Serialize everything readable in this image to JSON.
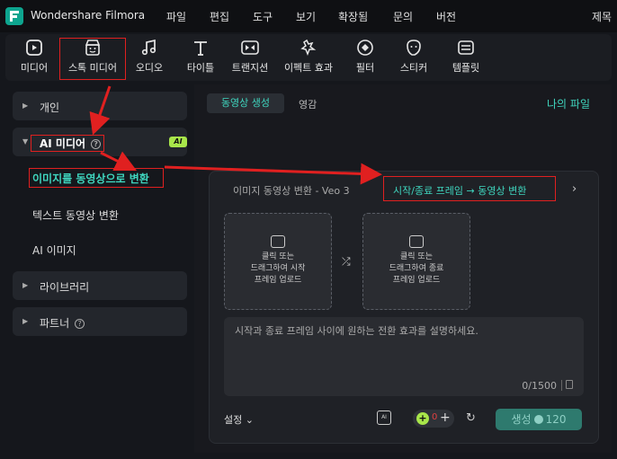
{
  "app": {
    "title": "Wondershare Filmora",
    "logo": "filmora-logo-icon"
  },
  "menu": [
    "파일",
    "편집",
    "도구",
    "보기",
    "확장됨",
    "문의",
    "버전",
    "제목"
  ],
  "toolbar": {
    "items": [
      {
        "label": "미디어",
        "icon": "media-icon"
      },
      {
        "label": "스톡 미디어",
        "icon": "stock-media-icon"
      },
      {
        "label": "오디오",
        "icon": "music-note-icon"
      },
      {
        "label": "타이틀",
        "icon": "text-t-icon"
      },
      {
        "label": "트랜지션",
        "icon": "transition-icon"
      },
      {
        "label": "이펙트 효과",
        "icon": "effects-icon"
      },
      {
        "label": "필터",
        "icon": "filter-icon"
      },
      {
        "label": "스티커",
        "icon": "sticker-icon"
      },
      {
        "label": "템플릿",
        "icon": "template-icon"
      }
    ]
  },
  "sidebar": {
    "personal": "개인",
    "ai_media": "AI 미디어",
    "ai_badge": "AI",
    "items": [
      "이미지를 동영상으로 변환",
      "텍스트 동영상 변환",
      "AI 이미지"
    ],
    "library": "라이브러리",
    "partner": "파트너"
  },
  "main": {
    "tab_active": "동영상 생성",
    "tab_other": "영감",
    "my_files": "나의 파일"
  },
  "panel": {
    "tab1": "이미지 동영상 변환 - Veo 3",
    "tab2": "시작/종료 프레임 → 동영상 변환",
    "chevron": "›",
    "upload_start": "클릭 또는\n드래그하여 시작\n프레임 업로드",
    "upload_end": "클릭 또는\n드래그하여 종료\n프레임 업로드",
    "prompt_placeholder": "시작과 종료 프레임 사이에 원하는 전환 효과를 설명하세요.",
    "char_count": "0/1500",
    "settings_label": "설정",
    "credit_value": "0",
    "generate_label": "생성",
    "generate_cost": "120"
  },
  "colors": {
    "accent": "#3fd6bf",
    "annotation_red": "#e02020",
    "ai_badge": "#a8e64a"
  }
}
